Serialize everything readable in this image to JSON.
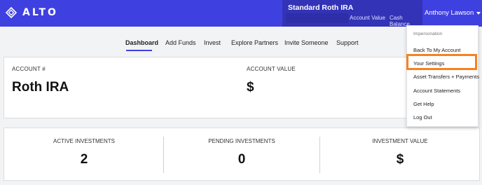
{
  "brand": {
    "name": "ALTO",
    "accent": "#3f40e0",
    "highlight": "#f58220"
  },
  "account": {
    "title": "Standard Roth IRA",
    "metrics": [
      "Account Value",
      "Cash Balance"
    ]
  },
  "user": {
    "name": "Anthony Lawson",
    "icon": "chevron-down-icon"
  },
  "nav": {
    "items": [
      "Dashboard",
      "Add Funds",
      "Invest",
      "Explore Partners",
      "Invite Someone",
      "Support"
    ],
    "active": "Dashboard"
  },
  "account_card": {
    "account_label": "ACCOUNT #",
    "account_value": "Roth IRA",
    "value_label": "ACCOUNT VALUE",
    "value_value": "$"
  },
  "stats": [
    {
      "label": "ACTIVE INVESTMENTS",
      "value": "2"
    },
    {
      "label": "PENDING INVESTMENTS",
      "value": "0"
    },
    {
      "label": "INVESTMENT VALUE",
      "value": "$"
    }
  ],
  "dropdown": {
    "header": "Impersonation",
    "items": [
      "Back To My Account",
      "Your Settings",
      "Asset Transfers + Payments",
      "Account Statements",
      "Get Help",
      "Log Out"
    ],
    "highlighted": "Your Settings"
  }
}
